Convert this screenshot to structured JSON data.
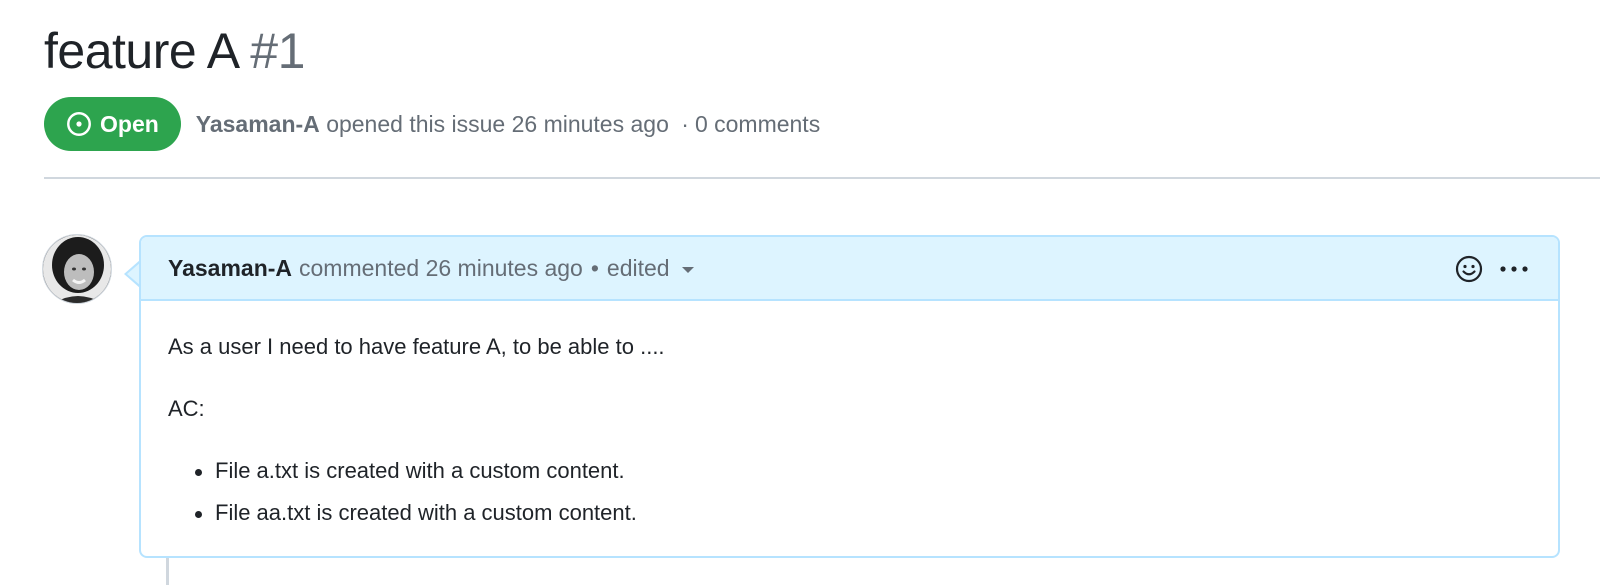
{
  "issue": {
    "title": "feature A",
    "number": "#1",
    "state": "Open",
    "state_color": "#2da44e",
    "author": "Yasaman-A",
    "opened_text": "opened this issue 26 minutes ago",
    "separator": "·",
    "comments_count": "0 comments"
  },
  "comment": {
    "author": "Yasaman-A",
    "action_text": "commented 26 minutes ago",
    "bullet": "•",
    "edited_label": "edited",
    "emoji_icon": "smiley-icon",
    "menu_icon": "kebab-horizontal-icon",
    "body": {
      "paragraph": "As a user I need to have feature A, to be able to ....",
      "ac_label": "AC:",
      "items": [
        "File a.txt is created with a custom content.",
        "File aa.txt is created with a custom content."
      ]
    },
    "header_bg": "#ddf4ff",
    "border_color": "#b6e3ff"
  }
}
